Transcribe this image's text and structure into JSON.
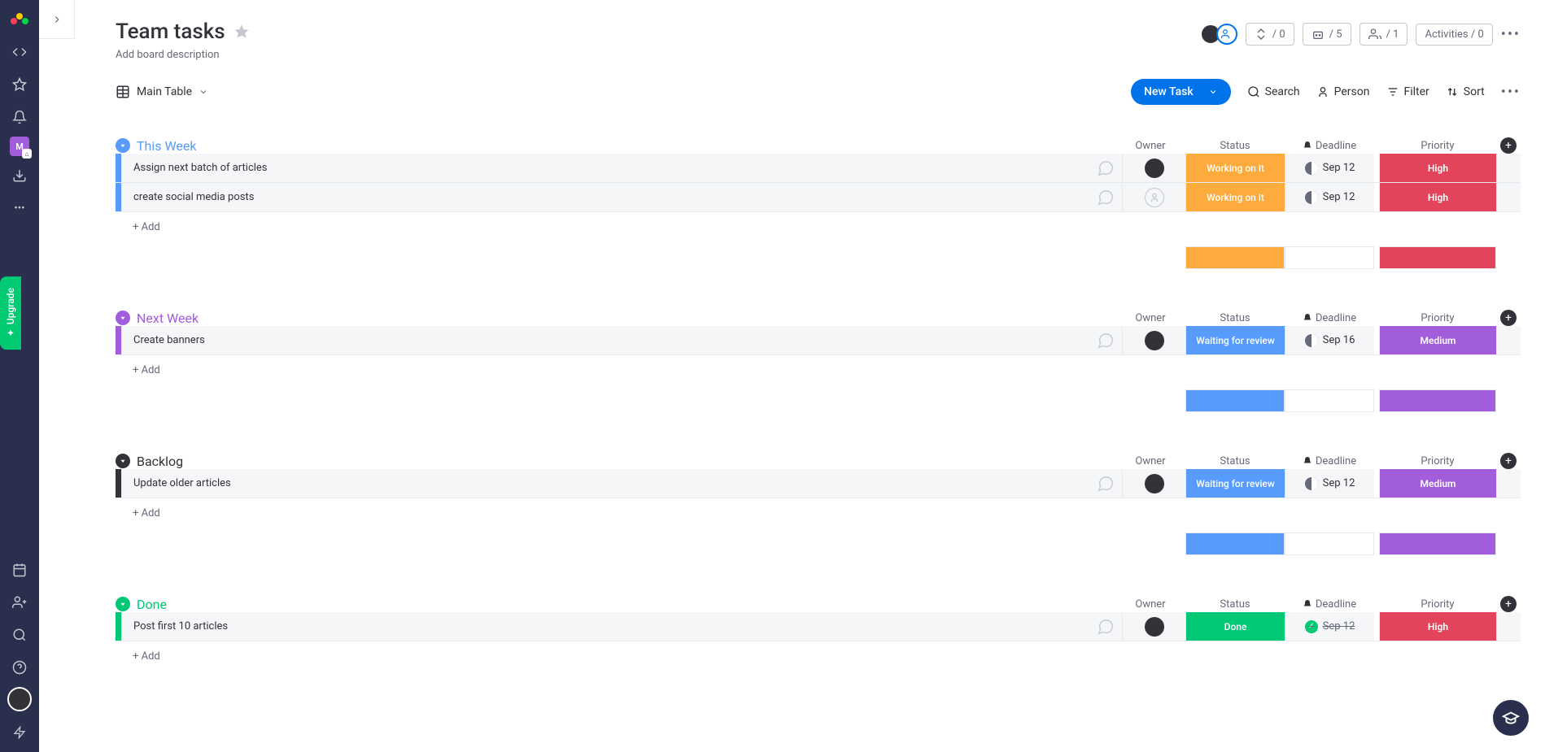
{
  "board_title": "Team tasks",
  "board_description_placeholder": "Add board description",
  "view_name": "Main Table",
  "header_widgets": {
    "integrations_count": "/ 0",
    "automations_count": "/ 5",
    "members_count": "/ 1",
    "activities_label": "Activities / 0"
  },
  "toolbar": {
    "new_task": "New Task",
    "search": "Search",
    "person": "Person",
    "filter": "Filter",
    "sort": "Sort"
  },
  "column_labels": {
    "owner": "Owner",
    "status": "Status",
    "deadline": "Deadline",
    "priority": "Priority"
  },
  "add_row_label": "+ Add",
  "upgrade_label": "✦ Upgrade",
  "groups": [
    {
      "id": "this_week",
      "title": "This Week",
      "color": "#579bfc",
      "tasks": [
        {
          "name": "Assign next batch of articles",
          "owner": "avatar",
          "status": "Working on it",
          "status_color": "#fdab3d",
          "deadline": "Sep 12",
          "deadline_done": false,
          "priority": "High",
          "priority_color": "#e2445c"
        },
        {
          "name": "create social media posts",
          "owner": "empty",
          "status": "Working on it",
          "status_color": "#fdab3d",
          "deadline": "Sep 12",
          "deadline_done": false,
          "priority": "High",
          "priority_color": "#e2445c"
        }
      ],
      "summary": {
        "status_color": "#fdab3d",
        "priority_color": "#e2445c"
      }
    },
    {
      "id": "next_week",
      "title": "Next Week",
      "color": "#a25ddc",
      "tasks": [
        {
          "name": "Create banners",
          "owner": "avatar",
          "status": "Waiting for review",
          "status_color": "#579bfc",
          "deadline": "Sep 16",
          "deadline_done": false,
          "priority": "Medium",
          "priority_color": "#a25ddc"
        }
      ],
      "summary": {
        "status_color": "#579bfc",
        "priority_color": "#a25ddc"
      }
    },
    {
      "id": "backlog",
      "title": "Backlog",
      "color": "#323338",
      "tasks": [
        {
          "name": "Update older articles",
          "owner": "avatar",
          "status": "Waiting for review",
          "status_color": "#579bfc",
          "deadline": "Sep 12",
          "deadline_done": false,
          "priority": "Medium",
          "priority_color": "#a25ddc"
        }
      ],
      "summary": {
        "status_color": "#579bfc",
        "priority_color": "#a25ddc"
      }
    },
    {
      "id": "done",
      "title": "Done",
      "color": "#00c875",
      "tasks": [
        {
          "name": "Post first 10 articles",
          "owner": "avatar",
          "status": "Done",
          "status_color": "#00c875",
          "deadline": "Sep 12",
          "deadline_done": true,
          "priority": "High",
          "priority_color": "#e2445c"
        }
      ],
      "summary": null
    }
  ]
}
